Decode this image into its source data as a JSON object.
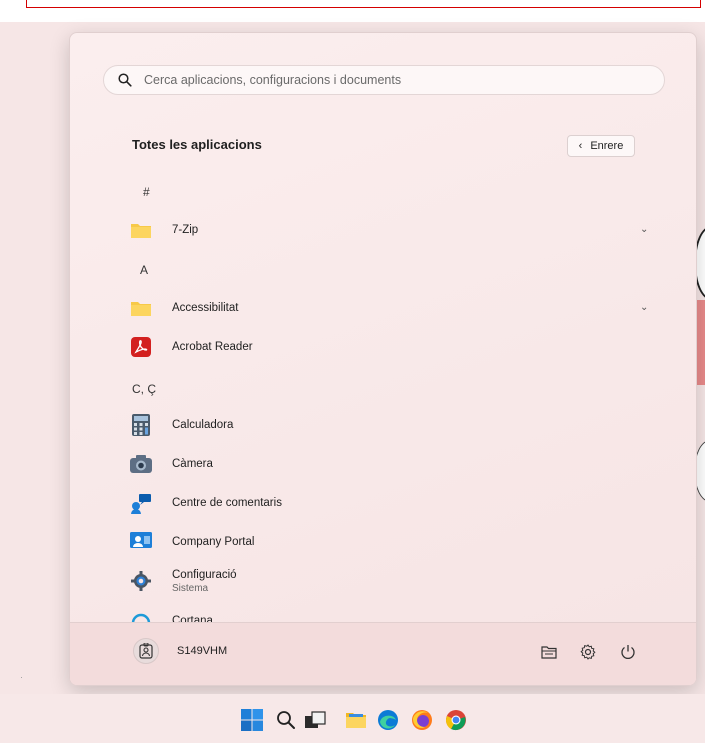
{
  "search": {
    "placeholder": "Cerca aplicacions, configuracions i documents"
  },
  "list": {
    "heading": "Totes les aplicacions",
    "back_label": "Enrere",
    "sections": [
      {
        "letter": "#"
      },
      {
        "letter": "A"
      },
      {
        "letter": "C, Ç"
      }
    ],
    "apps": [
      {
        "label": "7-Zip",
        "icon": "folder-icon",
        "expandable": true
      },
      {
        "label": "Accessibilitat",
        "icon": "folder-icon",
        "expandable": true
      },
      {
        "label": "Acrobat Reader",
        "icon": "acrobat-icon"
      },
      {
        "label": "Calculadora",
        "icon": "calculator-icon"
      },
      {
        "label": "Càmera",
        "icon": "camera-icon"
      },
      {
        "label": "Centre de comentaris",
        "icon": "feedback-hub-icon"
      },
      {
        "label": "Company Portal",
        "icon": "company-portal-icon"
      },
      {
        "label": "Configuració",
        "sublabel": "Sistema",
        "icon": "settings-gear-icon"
      },
      {
        "label": "Cortana",
        "icon": "cortana-icon"
      }
    ]
  },
  "footer": {
    "user_name": "S149VHM"
  },
  "colors": {
    "menu_bg": "#f8e8e8",
    "folder": "#f7c948",
    "acrobat": "#d3201f",
    "windows_blue": "#1e7fd8"
  }
}
